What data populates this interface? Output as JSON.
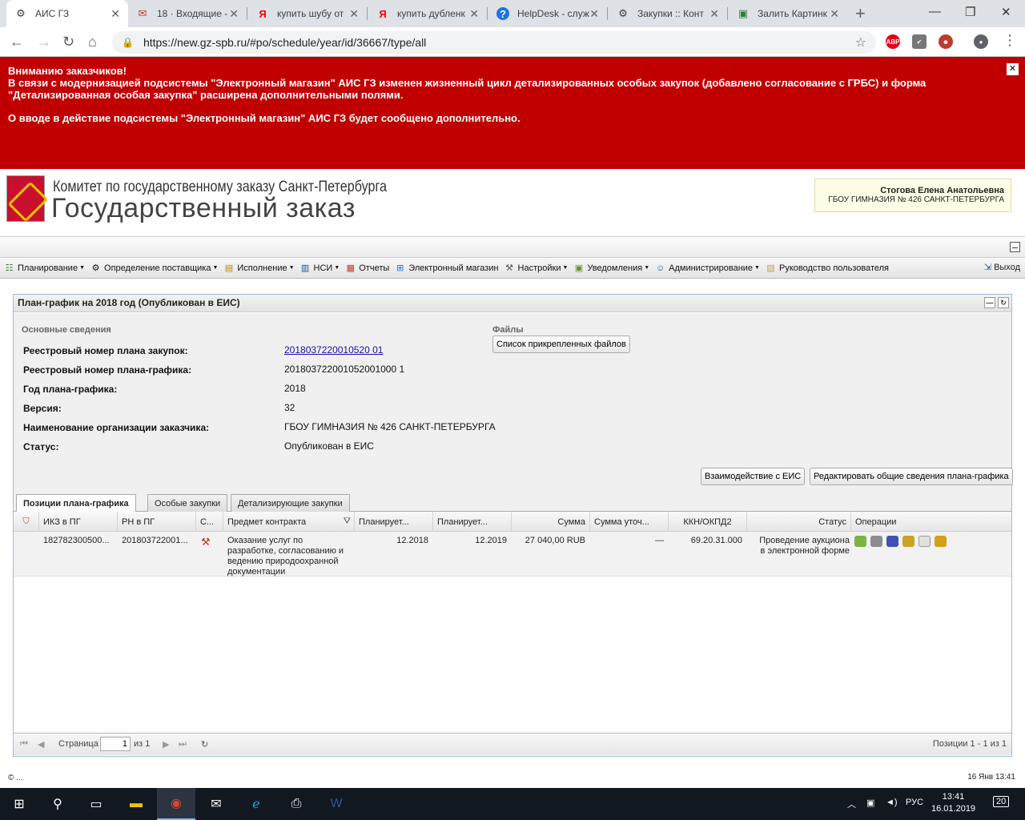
{
  "browser": {
    "tabs": [
      {
        "label": "АИС ГЗ",
        "icon": "settings-icon",
        "active": true
      },
      {
        "label": "18 · Входящие -",
        "icon": "gmail-icon"
      },
      {
        "label": "купить шубу от",
        "icon": "yandex-icon"
      },
      {
        "label": "купить дубленк",
        "icon": "yandex-icon"
      },
      {
        "label": "HelpDesk - служ",
        "icon": "helpdesk-icon"
      },
      {
        "label": "Закупки :: Конт",
        "icon": "gear-icon"
      },
      {
        "label": "Залить Картинк",
        "icon": "image-icon"
      }
    ],
    "url": "https://new.gz-spb.ru/#po/schedule/year/id/36667/type/all",
    "ext_abp": "ABP"
  },
  "banner": {
    "line1": "Вниманию заказчиков!",
    "line2": "В связи с модернизацией подсистемы \"Электронный магазин\" АИС ГЗ изменен жизненный цикл детализированных особых закупок (добавлено согласование с ГРБС) и форма \"Детализированная особая закупка\" расширена дополнительными полями.",
    "line3": "О вводе в действие подсистемы \"Электронный магазин\" АИС ГЗ будет сообщено дополнительно."
  },
  "header": {
    "org_top": "Комитет по государственному заказу Санкт-Петербурга",
    "org_main": "Государственный заказ",
    "user_name": "Стогова Елена Анатольевна",
    "user_org": "ГБОУ ГИМНАЗИЯ № 426 САНКТ-ПЕТЕРБУРГА"
  },
  "menu": [
    {
      "label": "Планирование",
      "icon": "planning-icon",
      "dropdown": true
    },
    {
      "label": "Определение поставщика",
      "icon": "gear-icon",
      "dropdown": true
    },
    {
      "label": "Исполнение",
      "icon": "execution-icon",
      "dropdown": true
    },
    {
      "label": "НСИ",
      "icon": "book-icon",
      "dropdown": true
    },
    {
      "label": "Отчеты",
      "icon": "report-icon",
      "dropdown": false
    },
    {
      "label": "Электронный магазин",
      "icon": "cart-icon",
      "dropdown": false
    },
    {
      "label": "Настройки",
      "icon": "wrench-icon",
      "dropdown": true
    },
    {
      "label": "Уведомления",
      "icon": "notification-icon",
      "dropdown": true
    },
    {
      "label": "Администрирование",
      "icon": "user-icon",
      "dropdown": true
    },
    {
      "label": "Руководство пользователя",
      "icon": "manual-icon",
      "dropdown": false
    }
  ],
  "logout": "Выход",
  "panel": {
    "title": "План-график на 2018 год (Опубликован в ЕИС)",
    "section_main": "Основные сведения",
    "section_files": "Файлы",
    "files_button": "Список прикрепленных файлов",
    "fields": [
      {
        "label": "Реестровый номер плана закупок:",
        "value": "2018037220010520 01",
        "link": true
      },
      {
        "label": "Реестровый номер плана-графика:",
        "value": "201803722001052001000 1"
      },
      {
        "label": "Год плана-графика:",
        "value": "2018"
      },
      {
        "label": "Версия:",
        "value": "32"
      },
      {
        "label": "Наименование организации заказчика:",
        "value": "ГБОУ ГИМНАЗИЯ № 426 САНКТ-ПЕТЕРБУРГА"
      },
      {
        "label": "Статус:",
        "value": "Опубликован в ЕИС"
      }
    ],
    "btn_eis": "Взаимодействие с ЕИС",
    "btn_edit": "Редактировать общие сведения плана-графика"
  },
  "grid_tabs": [
    "Позиции плана-графика",
    "Особые закупки",
    "Детализирующие закупки"
  ],
  "grid": {
    "columns": [
      "ИКЗ в ПГ",
      "РН в ПГ",
      "С...",
      "Предмет контракта",
      "Планирует...",
      "Планирует...",
      "Сумма",
      "Сумма уточ...",
      "ККН/ОКПД2",
      "Статус",
      "Операции"
    ],
    "rows": [
      {
        "ikz": "182782300500...",
        "rn": "201803722001...",
        "subject": "Оказание услуг по разработке, согласованию и ведению природоохранной документации",
        "plan1": "12.2018",
        "plan2": "12.2019",
        "sum": "27 040,00 RUB",
        "sum_refined": "—",
        "okpd": "69.20.31.000",
        "status": "Проведение аукциона в электронной форме"
      }
    ]
  },
  "pager": {
    "page_label": "Страница",
    "page_value": "1",
    "of_label": "из 1",
    "summary": "Позиции 1 - 1 из 1"
  },
  "footer": {
    "left": "© ...",
    "right": "16 Янв 13:41"
  },
  "taskbar": {
    "lang": "РУС",
    "time": "13:41",
    "date": "16.01.2019",
    "notifications": "20"
  }
}
